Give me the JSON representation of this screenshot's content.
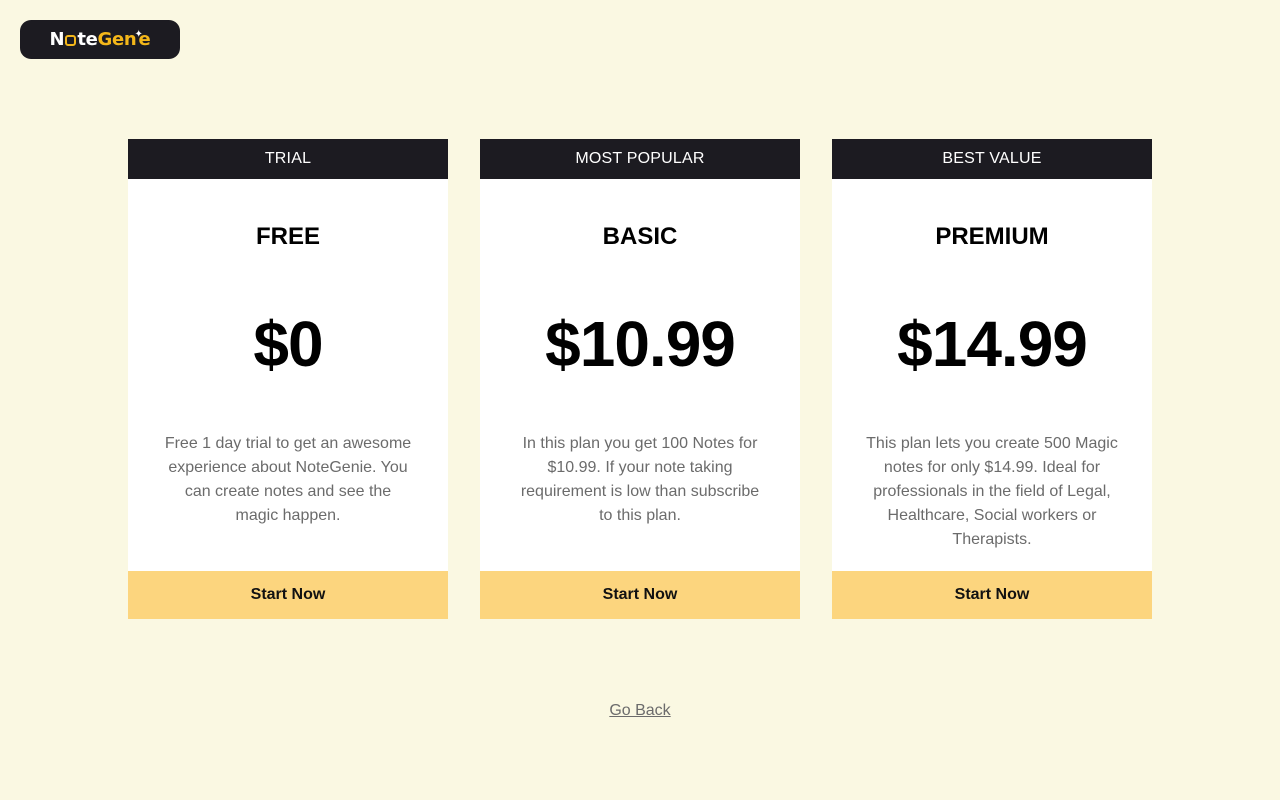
{
  "brand": {
    "name_part1": "N",
    "name_part2": "te",
    "name_part3": "Gen",
    "name_part4": "e"
  },
  "plans": [
    {
      "badge": "TRIAL",
      "name": "FREE",
      "price": "$0",
      "description": "Free 1 day trial to get an awesome experience about NoteGenie. You can create notes and see the magic happen.",
      "button_label": "Start Now"
    },
    {
      "badge": "MOST POPULAR",
      "name": "BASIC",
      "price": "$10.99",
      "description": "In this plan you get 100 Notes for $10.99. If your note taking requirement is low than subscribe to this plan.",
      "button_label": "Start Now"
    },
    {
      "badge": "BEST VALUE",
      "name": "PREMIUM",
      "price": "$14.99",
      "description": "This plan lets you create 500 Magic notes for only $14.99. Ideal for professionals in the field of Legal, Healthcare, Social workers or Therapists.",
      "button_label": "Start Now"
    }
  ],
  "footer": {
    "go_back_label": "Go Back"
  },
  "colors": {
    "background": "#faf8e2",
    "header_dark": "#1c1b21",
    "button_yellow": "#fcd57e",
    "brand_gold": "#f4b71a"
  }
}
